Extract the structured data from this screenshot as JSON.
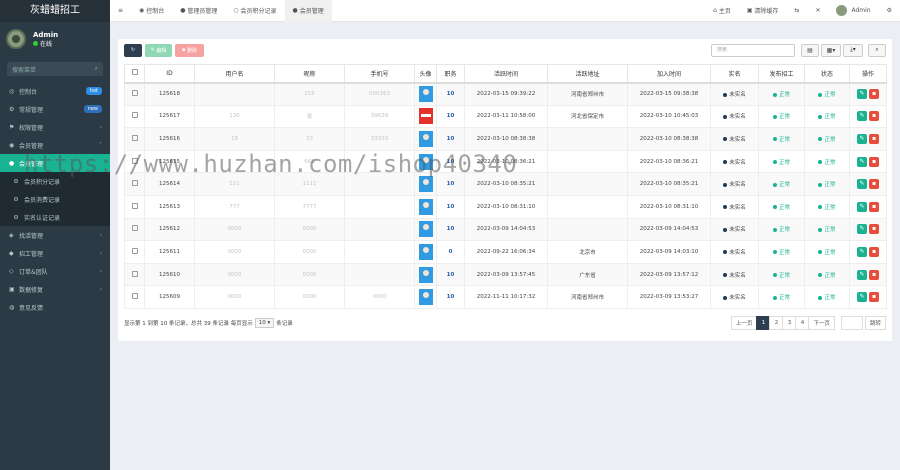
{
  "app": {
    "title": "灰蜡蜡招工"
  },
  "user": {
    "name": "Admin",
    "status": "在线"
  },
  "sidebar": {
    "search_placeholder": "搜索菜单",
    "items": [
      {
        "label": "控制台",
        "badge": "hot",
        "badge_color": "#2d8ce3"
      },
      {
        "label": "常规管理",
        "badge": "new",
        "badge_color": "#2c6fbb"
      },
      {
        "label": "权限管理",
        "caret": "‹"
      },
      {
        "label": "会员管理",
        "caret": "˅"
      },
      {
        "label": "会员管理",
        "active": true
      },
      {
        "label": "会员积分记录",
        "sub": true
      },
      {
        "label": "会员消费记录",
        "sub": true
      },
      {
        "label": "实名认证记录",
        "sub": true
      },
      {
        "label": "找活管理",
        "caret": "‹"
      },
      {
        "label": "招工管理",
        "caret": "‹"
      },
      {
        "label": "订单&团队",
        "caret": "‹"
      },
      {
        "label": "数据修复",
        "caret": "‹"
      },
      {
        "label": "意见反馈"
      }
    ]
  },
  "topbar": {
    "tabs": [
      {
        "label": "控制台"
      },
      {
        "label": "管理员管理"
      },
      {
        "label": "会员积分记录"
      },
      {
        "label": "会员管理",
        "active": true
      }
    ],
    "home": "主页",
    "clear_cache": "清除缓存",
    "admin": "Admin"
  },
  "toolbar": {
    "edit": "编辑",
    "delete": "删除",
    "search_placeholder": "搜索"
  },
  "table": {
    "headers": [
      "ID",
      "用户名",
      "昵称",
      "手机号",
      "头像",
      "职务",
      "活跃时间",
      "活跃地址",
      "加入时间",
      "实名",
      "发布招工",
      "状态",
      "操作"
    ],
    "rows": [
      {
        "id": "125618",
        "username": "",
        "nickname": "155",
        "phone": "000163",
        "avatar": "blue",
        "identity": "10",
        "active_time": "2022-03-15 09:39:22",
        "active_addr": "河南省郑州市",
        "join_time": "2022-03-15 09:38:38",
        "realname": "未实名",
        "post_job": "正常",
        "status": "正常"
      },
      {
        "id": "125617",
        "username": "130",
        "nickname": "张",
        "phone": "39639",
        "avatar": "red",
        "identity": "10",
        "active_time": "2022-03-11 10:58:00",
        "active_addr": "河北省保定市",
        "join_time": "2022-03-10 10:45:03",
        "realname": "未实名",
        "post_job": "正常",
        "status": "正常"
      },
      {
        "id": "125616",
        "username": "18",
        "nickname": "33",
        "phone": "33333",
        "avatar": "blue",
        "identity": "10",
        "active_time": "2022-03-10 08:38:38",
        "active_addr": "",
        "join_time": "2022-03-10 08:38:38",
        "realname": "未实名",
        "post_job": "正常",
        "status": "正常"
      },
      {
        "id": "125615",
        "username": "",
        "nickname": "666",
        "phone": "",
        "avatar": "blue",
        "identity": "10",
        "active_time": "2022-03-10 08:36:21",
        "active_addr": "",
        "join_time": "2022-03-10 08:36:21",
        "realname": "未实名",
        "post_job": "正常",
        "status": "正常"
      },
      {
        "id": "125614",
        "username": "111",
        "nickname": "1111",
        "phone": "",
        "avatar": "blue",
        "identity": "10",
        "active_time": "2022-03-10 08:35:21",
        "active_addr": "",
        "join_time": "2022-03-10 08:35:21",
        "realname": "未实名",
        "post_job": "正常",
        "status": "正常"
      },
      {
        "id": "125613",
        "username": "777",
        "nickname": "7777",
        "phone": "",
        "avatar": "blue",
        "identity": "10",
        "active_time": "2022-03-10 08:31:10",
        "active_addr": "",
        "join_time": "2022-03-10 08:31:10",
        "realname": "未实名",
        "post_job": "正常",
        "status": "正常"
      },
      {
        "id": "125612",
        "username": "0000",
        "nickname": "0000",
        "phone": "",
        "avatar": "blue",
        "identity": "10",
        "active_time": "2022-03-09 14:04:53",
        "active_addr": "",
        "join_time": "2022-03-09 14:04:53",
        "realname": "未实名",
        "post_job": "正常",
        "status": "正常"
      },
      {
        "id": "125611",
        "username": "0000",
        "nickname": "0000",
        "phone": "",
        "avatar": "blue",
        "identity": "0",
        "active_time": "2022-09-22 16:06:34",
        "active_addr": "北京市",
        "join_time": "2022-03-09 14:03:10",
        "realname": "未实名",
        "post_job": "正常",
        "status": "正常"
      },
      {
        "id": "125610",
        "username": "0000",
        "nickname": "0000",
        "phone": "",
        "avatar": "blue",
        "identity": "10",
        "active_time": "2022-03-09 13:57:45",
        "active_addr": "广东省",
        "join_time": "2022-03-09 13:57:12",
        "realname": "未实名",
        "post_job": "正常",
        "status": "正常"
      },
      {
        "id": "125609",
        "username": "0000",
        "nickname": "0000",
        "phone": "0000",
        "avatar": "blue",
        "identity": "10",
        "active_time": "2022-11-11 10:17:32",
        "active_addr": "河南省郑州市",
        "join_time": "2022-03-09 13:53:27",
        "realname": "未实名",
        "post_job": "正常",
        "status": "正常"
      }
    ]
  },
  "footer": {
    "summary": "显示第 1 到第 10 条记录，总共 39 条记录 每页显示",
    "per_page": "10",
    "per_suffix": "条记录",
    "prev": "上一页",
    "pages": [
      "1",
      "2",
      "3",
      "4"
    ],
    "current_page": "1",
    "next": "下一页",
    "jump": "跳转"
  },
  "watermark": "https://www.huzhan.com/ishop40340",
  "colors": {
    "sidebar": "#2c3a45",
    "accent": "#19b394",
    "danger": "#e74c3c",
    "pager_active": "#2c3e50"
  }
}
